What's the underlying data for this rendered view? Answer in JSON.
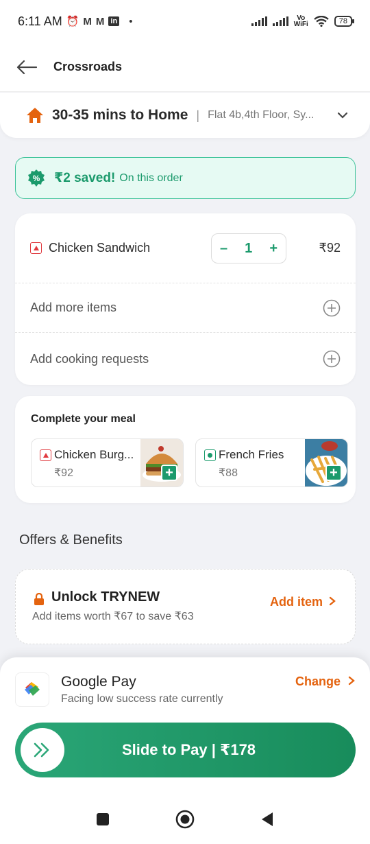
{
  "status": {
    "time": "6:11 AM",
    "battery": "78",
    "network": "Vo WiFi"
  },
  "header": {
    "title": "Crossroads"
  },
  "delivery": {
    "eta": "30-35 mins to Home",
    "separator": "|",
    "address": "Flat 4b,4th Floor, Sy..."
  },
  "savings": {
    "amount": "₹2 saved!",
    "note": "On this order"
  },
  "cart": {
    "item_name": "Chicken Sandwich",
    "quantity": "1",
    "minus": "–",
    "plus": "+",
    "price": "₹92",
    "add_more": "Add more items",
    "cooking_requests": "Add cooking requests"
  },
  "meal": {
    "title": "Complete your meal",
    "items": [
      {
        "name": "Chicken Burg...",
        "price": "₹92",
        "type": "non-veg"
      },
      {
        "name": "French Fries",
        "price": "₹88",
        "type": "veg"
      }
    ],
    "add_symbol": "+"
  },
  "offers": {
    "title": "Offers & Benefits",
    "offer_title": "Unlock TRYNEW",
    "offer_sub": "Add items worth ₹67 to save ₹63",
    "offer_action": "Add item"
  },
  "payment": {
    "method": "Google Pay",
    "warning": "Facing low success rate currently",
    "change": "Change",
    "slide_label": "Slide to Pay | ₹178"
  },
  "colors": {
    "green": "#1b9a6c",
    "orange": "#e4630f",
    "nonveg_red": "#e0393e"
  }
}
